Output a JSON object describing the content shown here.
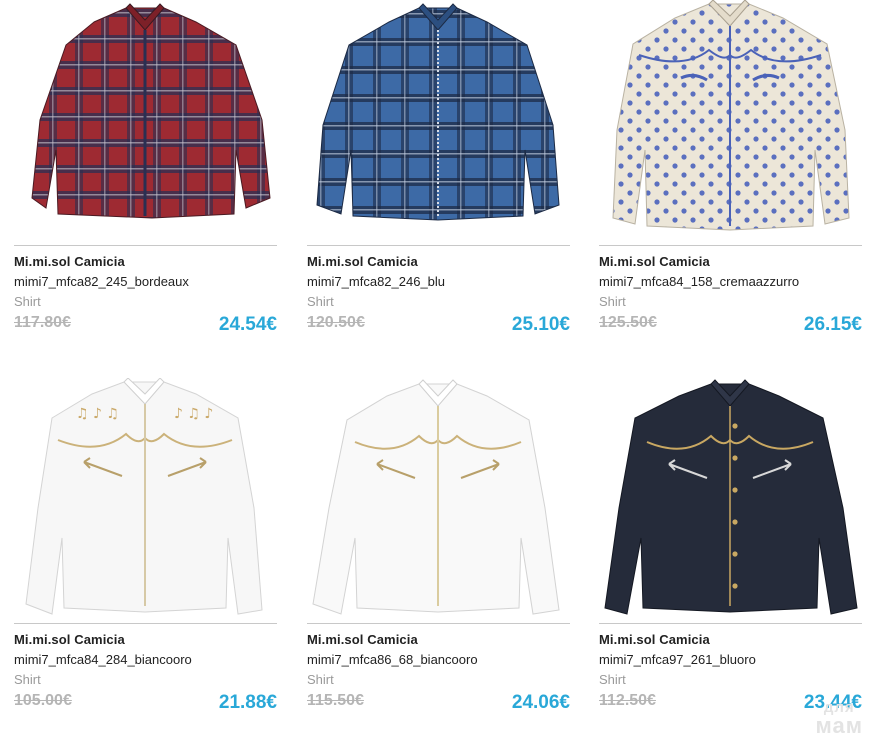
{
  "products": [
    {
      "brand": "Mi.mi.sol Camicia",
      "sku": "mimi7_mfca82_245_bordeaux",
      "category": "Shirt",
      "old_price": "117.80€",
      "price": "24.54€",
      "image": "red-plaid-shirt"
    },
    {
      "brand": "Mi.mi.sol Camicia",
      "sku": "mimi7_mfca82_246_blu",
      "category": "Shirt",
      "old_price": "120.50€",
      "price": "25.10€",
      "image": "blue-plaid-shirt"
    },
    {
      "brand": "Mi.mi.sol Camicia",
      "sku": "mimi7_mfca84_158_cremaazzurro",
      "category": "Shirt",
      "old_price": "125.50€",
      "price": "26.15€",
      "image": "cream-polka-dot-shirt"
    },
    {
      "brand": "Mi.mi.sol Camicia",
      "sku": "mimi7_mfca84_284_biancooro",
      "category": "Shirt",
      "old_price": "105.00€",
      "price": "21.88€",
      "image": "white-music-note-shirt"
    },
    {
      "brand": "Mi.mi.sol Camicia",
      "sku": "mimi7_mfca86_68_biancooro",
      "category": "Shirt",
      "old_price": "115.50€",
      "price": "24.06€",
      "image": "white-western-shirt"
    },
    {
      "brand": "Mi.mi.sol Camicia",
      "sku": "mimi7_mfca97_261_bluoro",
      "category": "Shirt",
      "old_price": "112.50€",
      "price": "23.44€",
      "image": "denim-western-shirt"
    }
  ],
  "watermark": {
    "line1": "для",
    "line2": "мам"
  },
  "colors": {
    "price": "#29a8d8",
    "old_price": "#b5b5b5",
    "divider": "#c8c8c8"
  }
}
